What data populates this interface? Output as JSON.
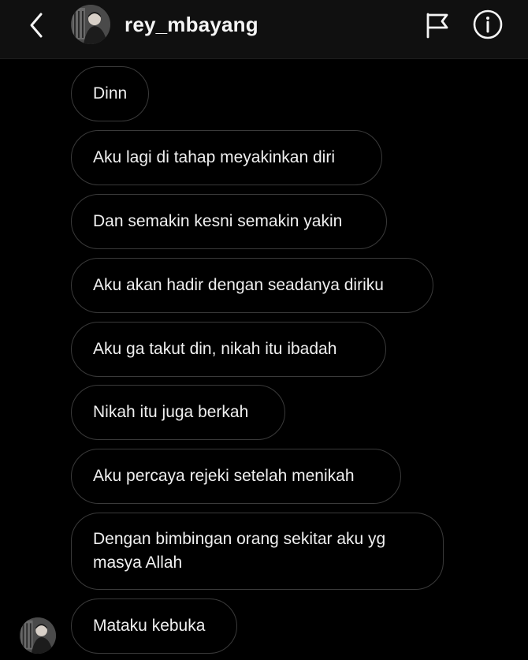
{
  "header": {
    "username": "rey_mbayang",
    "back_icon": "chevron-left-icon",
    "flag_icon": "flag-icon",
    "info_icon": "info-icon"
  },
  "messages": [
    {
      "text": "Dinn"
    },
    {
      "text": "Aku lagi di tahap meyakinkan diri"
    },
    {
      "text": "Dan semakin kesni semakin yakin"
    },
    {
      "text": "Aku akan hadir dengan seadanya diriku"
    },
    {
      "text": "Aku ga takut din, nikah itu ibadah"
    },
    {
      "text": "Nikah itu juga berkah"
    },
    {
      "text": "Aku percaya rejeki setelah menikah"
    },
    {
      "text": "Dengan bimbingan orang sekitar aku yg\nmasya Allah"
    },
    {
      "text": "Mataku kebuka"
    }
  ],
  "colors": {
    "background": "#000000",
    "header": "#101010",
    "bubble_border": "#3a3a3a",
    "text": "#f0f0f0"
  }
}
